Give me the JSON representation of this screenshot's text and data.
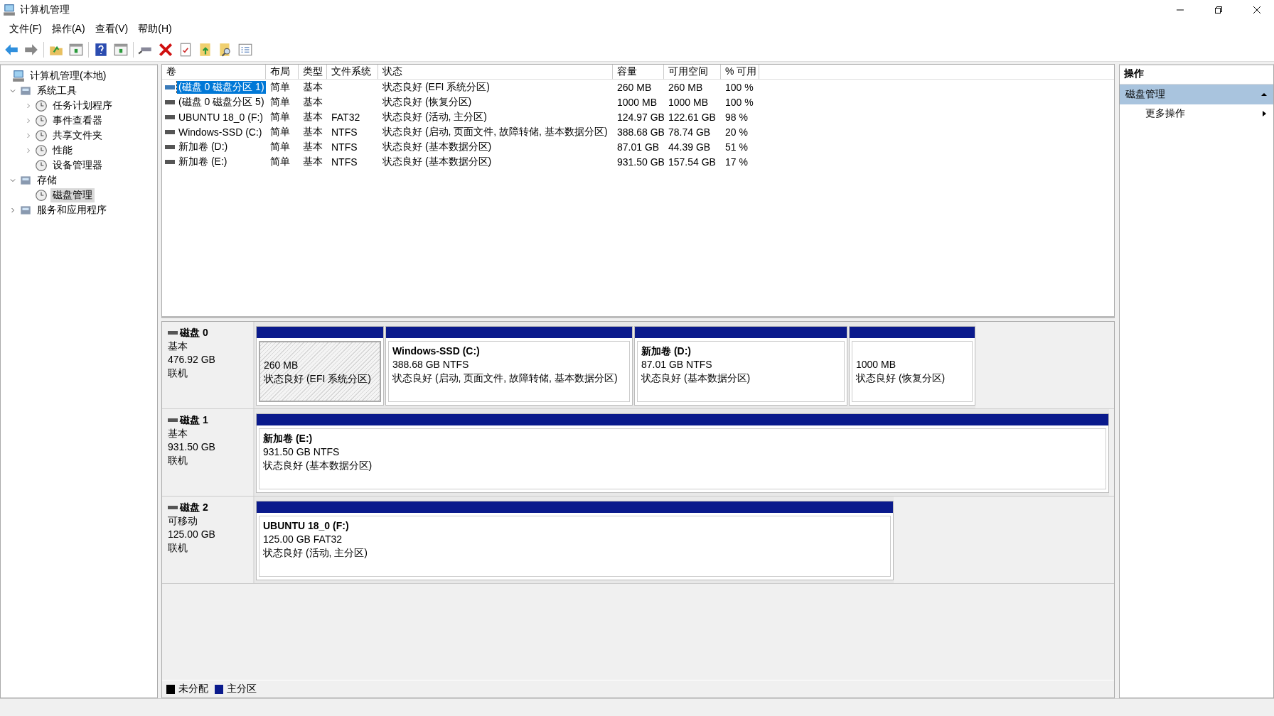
{
  "window": {
    "title": "计算机管理"
  },
  "menu": [
    "文件(F)",
    "操作(A)",
    "查看(V)",
    "帮助(H)"
  ],
  "tree": [
    {
      "label": "计算机管理(本地)",
      "selected": false,
      "children": [
        {
          "label": "系统工具",
          "expanded": true,
          "selected": false,
          "children": [
            {
              "label": "任务计划程序",
              "expanded": false,
              "selected": false
            },
            {
              "label": "事件查看器",
              "expanded": false,
              "selected": false
            },
            {
              "label": "共享文件夹",
              "expanded": false,
              "selected": false
            },
            {
              "label": "性能",
              "expanded": false,
              "selected": false
            },
            {
              "label": "设备管理器",
              "selected": false
            }
          ]
        },
        {
          "label": "存储",
          "expanded": true,
          "selected": false,
          "children": [
            {
              "label": "磁盘管理",
              "selected": true
            }
          ]
        },
        {
          "label": "服务和应用程序",
          "expanded": false,
          "selected": false
        }
      ]
    }
  ],
  "table": {
    "columns": [
      "卷",
      "布局",
      "类型",
      "文件系统",
      "状态",
      "容量",
      "可用空间",
      "% 可用"
    ],
    "rows": [
      {
        "selected": true,
        "cells": [
          "(磁盘 0 磁盘分区 1)",
          "简单",
          "基本",
          "",
          "状态良好 (EFI 系统分区)",
          "260 MB",
          "260 MB",
          "100 %"
        ]
      },
      {
        "selected": false,
        "cells": [
          "(磁盘 0 磁盘分区 5)",
          "简单",
          "基本",
          "",
          "状态良好 (恢复分区)",
          "1000 MB",
          "1000 MB",
          "100 %"
        ]
      },
      {
        "selected": false,
        "cells": [
          "UBUNTU 18_0 (F:)",
          "简单",
          "基本",
          "FAT32",
          "状态良好 (活动, 主分区)",
          "124.97 GB",
          "122.61 GB",
          "98 %"
        ]
      },
      {
        "selected": false,
        "cells": [
          "Windows-SSD (C:)",
          "简单",
          "基本",
          "NTFS",
          "状态良好 (启动, 页面文件, 故障转储, 基本数据分区)",
          "388.68 GB",
          "78.74 GB",
          "20 %"
        ]
      },
      {
        "selected": false,
        "cells": [
          "新加卷 (D:)",
          "简单",
          "基本",
          "NTFS",
          "状态良好 (基本数据分区)",
          "87.01 GB",
          "44.39 GB",
          "51 %"
        ]
      },
      {
        "selected": false,
        "cells": [
          "新加卷 (E:)",
          "简单",
          "基本",
          "NTFS",
          "状态良好 (基本数据分区)",
          "931.50 GB",
          "157.54 GB",
          "17 %"
        ]
      }
    ]
  },
  "disks": [
    {
      "name": "磁盘 0",
      "type": "基本",
      "size": "476.92 GB",
      "status": "联机",
      "partitions": [
        {
          "size": "260 MB",
          "status": "状态良好 (EFI 系统分区)",
          "selected": true
        },
        {
          "title": "Windows-SSD  (C:)",
          "size": "388.68 GB NTFS",
          "status": "状态良好 (启动, 页面文件, 故障转储, 基本数据分区)",
          "selected": false
        },
        {
          "title": "新加卷  (D:)",
          "size": "87.01 GB NTFS",
          "status": "状态良好 (基本数据分区)",
          "selected": false
        },
        {
          "size": "1000 MB",
          "status": "状态良好 (恢复分区)",
          "selected": false
        }
      ]
    },
    {
      "name": "磁盘 1",
      "type": "基本",
      "size": "931.50 GB",
      "status": "联机",
      "partitions": [
        {
          "title": "新加卷  (E:)",
          "size": "931.50 GB NTFS",
          "status": "状态良好 (基本数据分区)",
          "selected": false
        }
      ]
    },
    {
      "name": "磁盘 2",
      "type": "可移动",
      "size": "125.00 GB",
      "status": "联机",
      "partitions": [
        {
          "title": "UBUNTU 18_0  (F:)",
          "size": "125.00 GB FAT32",
          "status": "状态良好 (活动, 主分区)",
          "selected": false
        }
      ]
    }
  ],
  "legend": [
    {
      "label": "未分配",
      "color": "#000000"
    },
    {
      "label": "主分区",
      "color": "#0a1a8c"
    }
  ],
  "actions": {
    "title": "操作",
    "section": {
      "label": "磁盘管理",
      "expanded": true
    },
    "items": [
      "更多操作"
    ]
  }
}
